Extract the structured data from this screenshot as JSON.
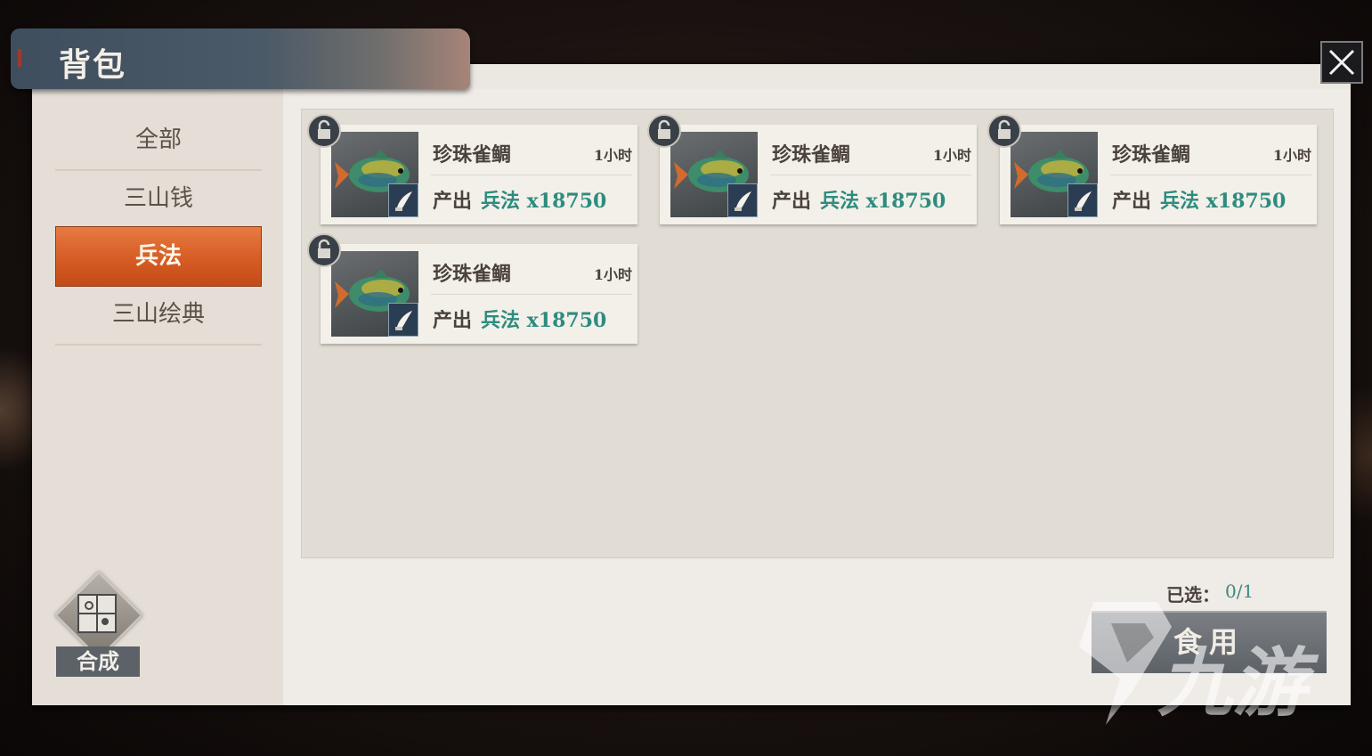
{
  "window": {
    "title": "背包"
  },
  "tabs": [
    {
      "label": "全部",
      "active": false
    },
    {
      "label": "三山钱",
      "active": false
    },
    {
      "label": "兵法",
      "active": true
    },
    {
      "label": "三山绘典",
      "active": false
    }
  ],
  "synthesize": {
    "label": "合成"
  },
  "items": [
    {
      "name": "珍珠雀鲷",
      "time": "1小时",
      "produce_label": "产出",
      "produce_value": "兵法 x18750",
      "icon": "fish-icon",
      "badge": "brush-icon",
      "locked": false
    },
    {
      "name": "珍珠雀鲷",
      "time": "1小时",
      "produce_label": "产出",
      "produce_value": "兵法 x18750",
      "icon": "fish-icon",
      "badge": "brush-icon",
      "locked": false
    },
    {
      "name": "珍珠雀鲷",
      "time": "1小时",
      "produce_label": "产出",
      "produce_value": "兵法 x18750",
      "icon": "fish-icon",
      "badge": "brush-icon",
      "locked": false
    },
    {
      "name": "珍珠雀鲷",
      "time": "1小时",
      "produce_label": "产出",
      "produce_value": "兵法 x18750",
      "icon": "fish-icon",
      "badge": "brush-icon",
      "locked": false
    }
  ],
  "selection": {
    "label": "已选：",
    "value": "0/1"
  },
  "use_button": {
    "label": "食用"
  },
  "watermark": {
    "text": "九游"
  },
  "colors": {
    "accent": "#d45a22",
    "produce_text": "#2e8c7f",
    "title_bar": "#46545f"
  }
}
